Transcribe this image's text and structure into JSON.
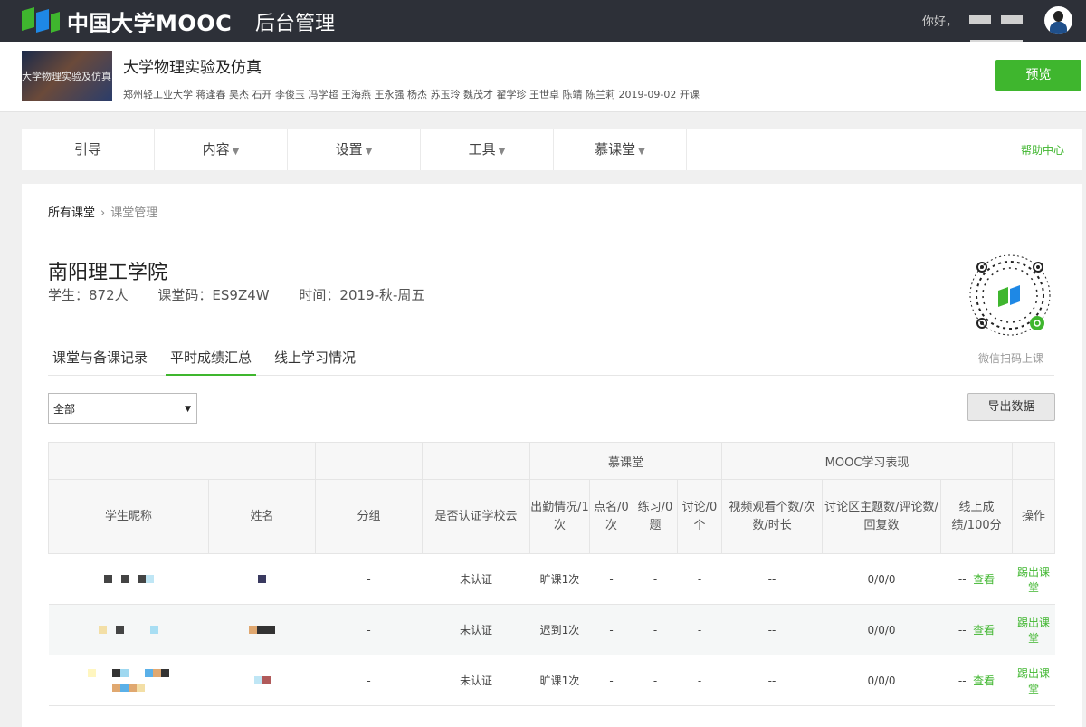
{
  "topbar": {
    "logo_text": "中国大学MOOC",
    "admin_text": "后台管理",
    "greeting": "你好，"
  },
  "course": {
    "cover_text": "大学物理实验及仿真",
    "title": "大学物理实验及仿真",
    "teachers": "郑州轻工业大学   蒋逢春 吴杰 石开 李俊玉 冯学超 王海燕 王永强 杨杰 苏玉玲 魏茂才 翟学珍 王世卓 陈靖 陈兰莉     2019-09-02 开课",
    "preview_label": "预览"
  },
  "nav": {
    "items": [
      {
        "label": "引导",
        "caret": ""
      },
      {
        "label": "内容",
        "caret": "▼"
      },
      {
        "label": "设置",
        "caret": "▼"
      },
      {
        "label": "工具",
        "caret": "▼"
      },
      {
        "label": "慕课堂",
        "caret": "▼"
      }
    ],
    "help": "帮助中心"
  },
  "breadcrumb": {
    "root": "所有课堂",
    "sep": "›",
    "current": "课堂管理"
  },
  "class": {
    "title": "南阳理工学院",
    "students": "学生：872人",
    "code": "课堂码：ES9Z4W",
    "time": "时间：2019-秋-周五",
    "qr_label": "微信扫码上课"
  },
  "tabs": [
    "课堂与备课记录",
    "平时成绩汇总",
    "线上学习情况"
  ],
  "filter": {
    "selected": "全部",
    "export_label": "导出数据"
  },
  "table": {
    "group_headers": {
      "mooc_hall": "慕课堂",
      "mooc_perf": "MOOC学习表现"
    },
    "headers": [
      "学生昵称",
      "姓名",
      "分组",
      "是否认证学校云",
      "出勤情况/1次",
      "点名/0次",
      "练习/0题",
      "讨论/0个",
      "视频观看个数/次数/时长",
      "讨论区主题数/评论数/回复数",
      "线上成绩/100分",
      "操作"
    ],
    "rows": [
      {
        "group": "-",
        "cert": "未认证",
        "attendance": "旷课1次",
        "rollcall": "-",
        "practice": "-",
        "discuss": "-",
        "video": "--",
        "forum": "0/0/0",
        "score": "--",
        "view": "查看",
        "action": "踢出课堂"
      },
      {
        "group": "-",
        "cert": "未认证",
        "attendance": "迟到1次",
        "rollcall": "-",
        "practice": "-",
        "discuss": "-",
        "video": "--",
        "forum": "0/0/0",
        "score": "--",
        "view": "查看",
        "action": "踢出课堂"
      },
      {
        "group": "-",
        "cert": "未认证",
        "attendance": "旷课1次",
        "rollcall": "-",
        "practice": "-",
        "discuss": "-",
        "video": "--",
        "forum": "0/0/0",
        "score": "--",
        "view": "查看",
        "action": "踢出课堂"
      }
    ]
  },
  "colors": {
    "accent": "#3fb62e",
    "topbar": "#2d3038"
  }
}
